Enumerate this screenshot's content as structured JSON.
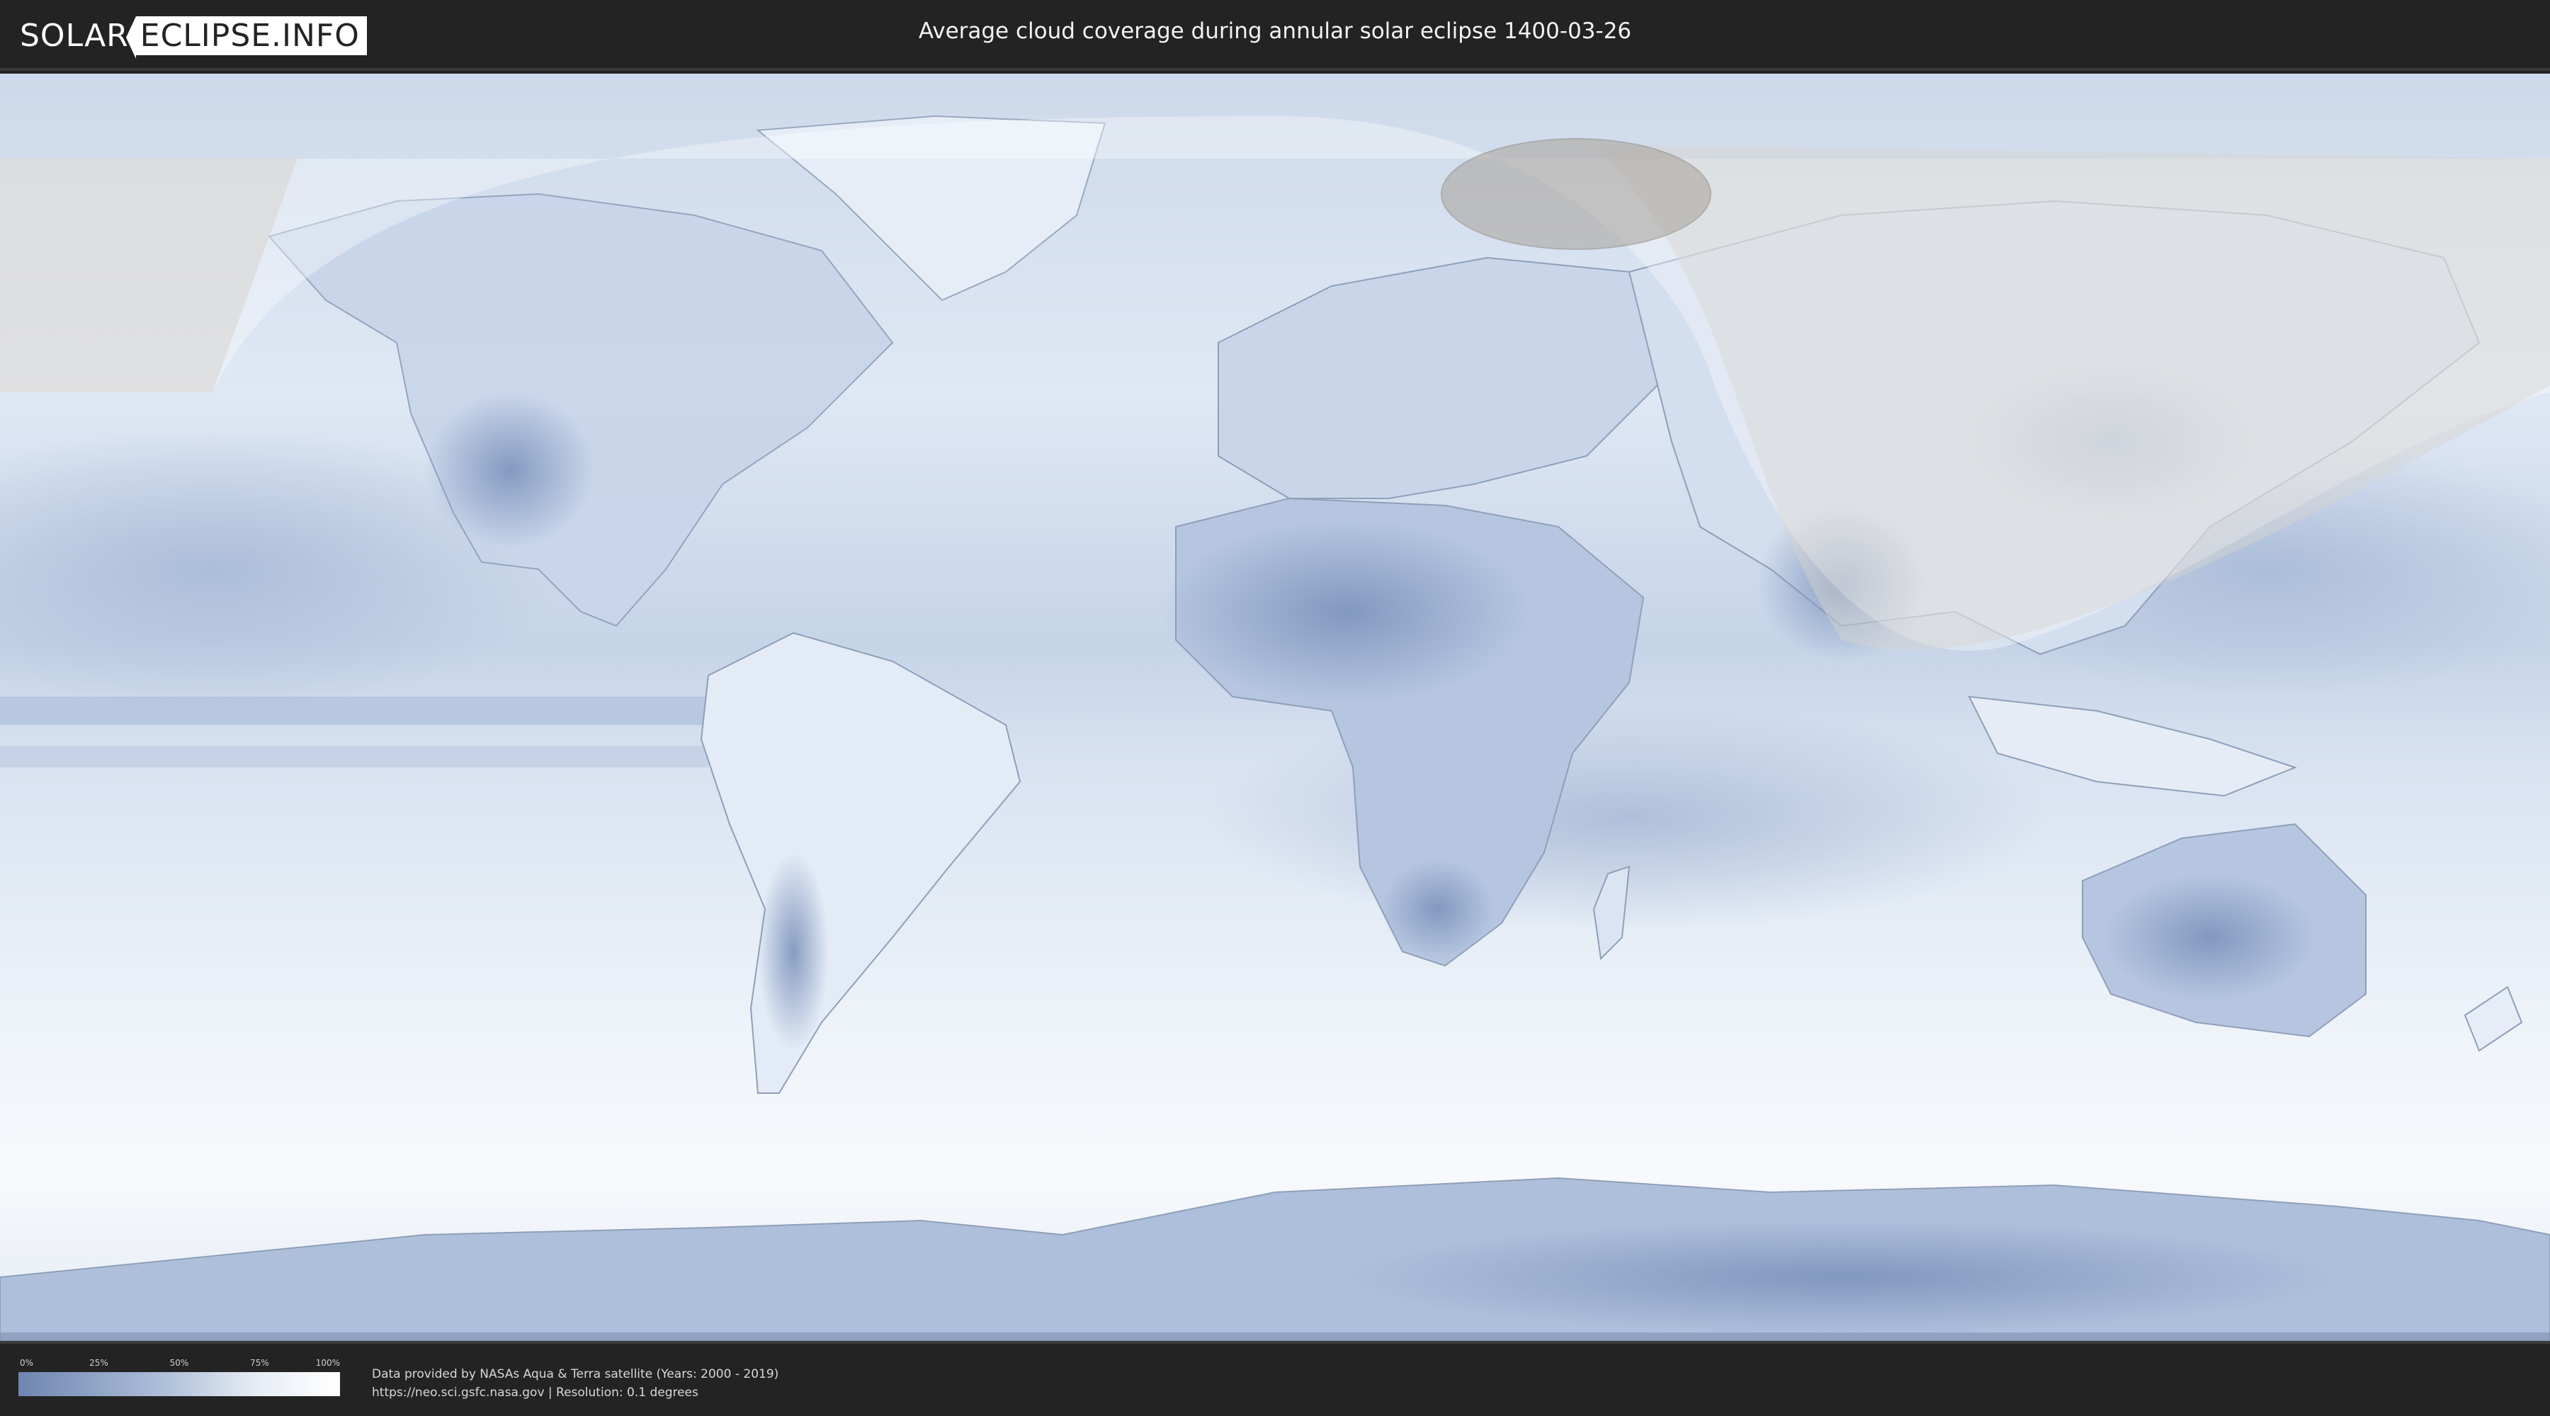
{
  "header": {
    "logo_part1": "SOLAR",
    "logo_part2": "ECLIPSE.INFO",
    "title": "Average cloud coverage during annular solar eclipse 1400-03-26"
  },
  "legend": {
    "ticks": [
      "0%",
      "25%",
      "50%",
      "75%",
      "100%"
    ]
  },
  "footer": {
    "credit_line1": "Data provided by NASAs Aqua & Terra satellite (Years: 2000 - 2019)",
    "credit_line2": "https://neo.sci.gsfc.nasa.gov | Resolution: 0.1 degrees"
  },
  "colors": {
    "ocean_base": "#dfe8f4",
    "land_clear": "#6f86b0",
    "cloud_white": "#ffffff",
    "visibility_overlay": "#d7d4d0",
    "annular_path": "#a9a29a"
  }
}
